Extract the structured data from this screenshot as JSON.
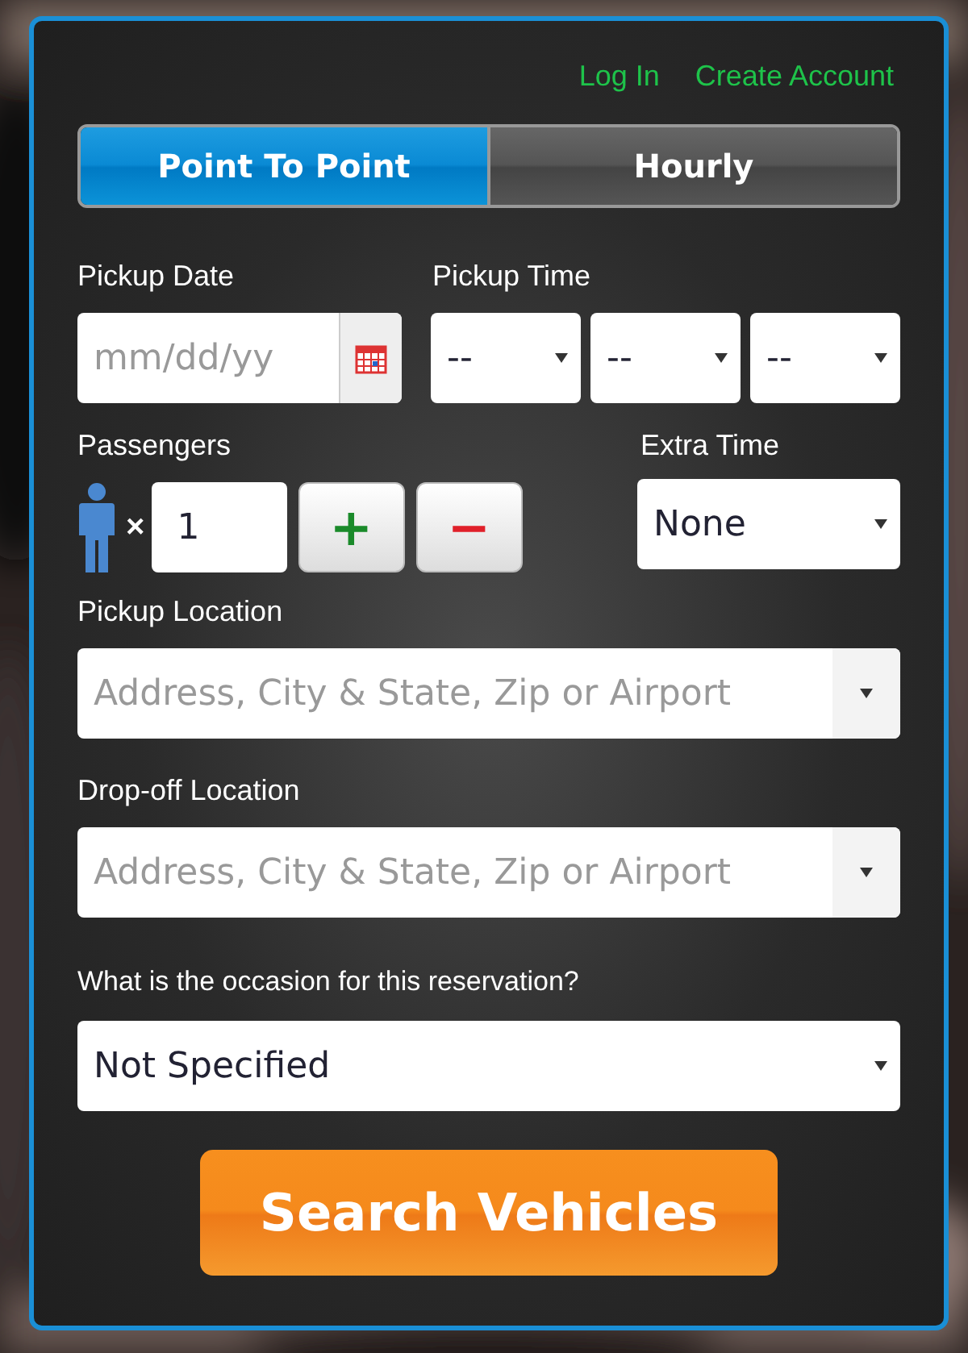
{
  "links": [
    {
      "label": "Log In"
    },
    {
      "label": "Create Account"
    }
  ],
  "tabs": [
    {
      "label": "Point To Point",
      "selected": true
    },
    {
      "label": "Hourly",
      "selected": false
    }
  ],
  "pickup_date": {
    "label": "Pickup Date",
    "placeholder": "mm/dd/yy"
  },
  "pickup_time": {
    "label": "Pickup Time",
    "selects": [
      "--",
      "--",
      "--"
    ]
  },
  "passengers": {
    "label": "Passengers",
    "multiply": "×",
    "value": "1",
    "plus": "+",
    "minus": "−"
  },
  "extra_time": {
    "label": "Extra Time",
    "value": "None"
  },
  "pickup_location": {
    "label": "Pickup Location",
    "placeholder": "Address, City & State, Zip or Airport"
  },
  "dropoff_location": {
    "label": "Drop-off Location",
    "placeholder": "Address, City & State, Zip or Airport"
  },
  "occasion": {
    "label": "What is the occasion for this reservation?",
    "value": "Not Specified"
  },
  "search_button": {
    "label": "Search Vehicles"
  }
}
